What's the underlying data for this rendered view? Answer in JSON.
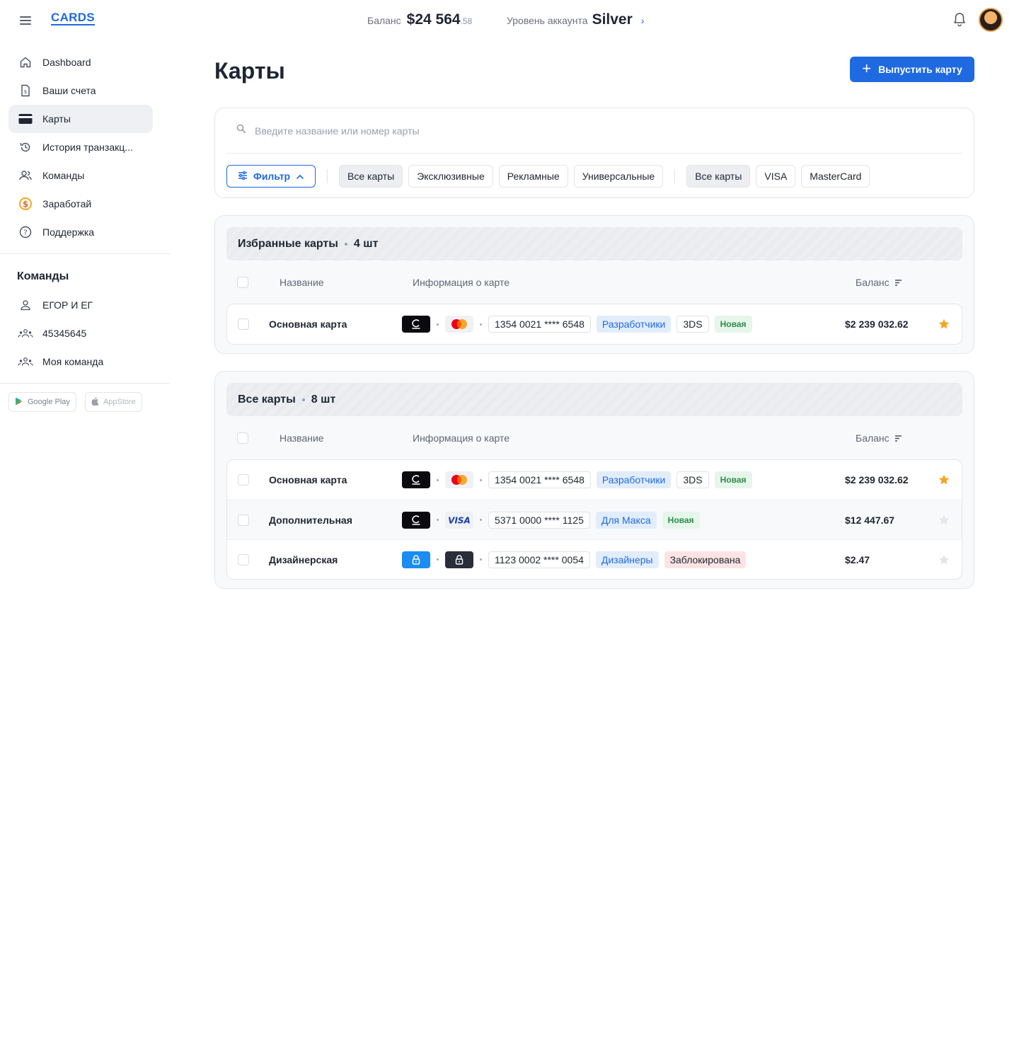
{
  "header": {
    "logo": "CARDS",
    "balance_label": "Баланс",
    "balance_main": "$24 564",
    "balance_cents": ".58",
    "level_label": "Уровень аккаунта",
    "level_value": "Silver"
  },
  "sidebar": {
    "items": [
      {
        "label": "Dashboard",
        "icon": "home-icon"
      },
      {
        "label": "Ваши счета",
        "icon": "document-dollar-icon"
      },
      {
        "label": "Карты",
        "icon": "card-icon",
        "active": true
      },
      {
        "label": "История транзакц...",
        "icon": "history-icon"
      },
      {
        "label": "Команды",
        "icon": "users-icon"
      },
      {
        "label": "Заработай",
        "icon": "dollar-coin-icon"
      },
      {
        "label": "Поддержка",
        "icon": "help-icon"
      }
    ],
    "teams_title": "Команды",
    "teams": [
      {
        "label": "ЕГОР И ЕГ",
        "icon": "user-icon"
      },
      {
        "label": "45345645",
        "icon": "team-icon"
      },
      {
        "label": "Моя команда",
        "icon": "team-icon"
      }
    ],
    "stores": {
      "google": "Google Play",
      "apple": "AppStore"
    }
  },
  "main": {
    "title": "Карты",
    "issue_button": "Выпустить карту",
    "search_placeholder": "Введите название или номер карты",
    "filter_button": "Фильтр",
    "type_chips": [
      "Все карты",
      "Эксклюзивные",
      "Рекламные",
      "Универсальные"
    ],
    "network_chips": [
      "Все карты",
      "VISA",
      "MasterCard"
    ],
    "columns": {
      "name": "Название",
      "info": "Информация о карте",
      "balance": "Баланс"
    },
    "favorites": {
      "title": "Избранные карты",
      "count": "4 шт",
      "rows": [
        {
          "name": "Основная карта",
          "brand": "c-logo",
          "network": "mastercard",
          "number": "1354 0021 **** 6548",
          "team": "Разработчики",
          "ds": "3DS",
          "status": "Новая",
          "status_type": "new",
          "balance": "$2 239 032.62",
          "starred": true
        }
      ]
    },
    "all": {
      "title": "Все карты",
      "count": "8 шт",
      "rows": [
        {
          "name": "Основная карта",
          "brand": "c-logo",
          "network": "mastercard",
          "number": "1354 0021 **** 6548",
          "team": "Разработчики",
          "ds": "3DS",
          "status": "Новая",
          "status_type": "new",
          "balance": "$2 239 032.62",
          "starred": true
        },
        {
          "name": "Дополнительная",
          "brand": "c-logo",
          "network": "visa",
          "number": "5371 0000 **** 1125",
          "team": "Для Макса",
          "ds": "",
          "status": "Новая",
          "status_type": "new",
          "balance": "$12 447.67",
          "starred": false
        },
        {
          "name": "Дизайнерская",
          "brand": "lock-blue",
          "network": "lock-dark",
          "number": "1123 0002 **** 0054",
          "team": "Дизайнеры",
          "ds": "",
          "status": "Заблокирована",
          "status_type": "blocked",
          "balance": "$2.47",
          "starred": false
        }
      ]
    },
    "colors": {
      "accent": "#1f6ae0",
      "star_on": "#f5a623",
      "star_off": "#e3e6ec",
      "new": "#2e8b4a",
      "blocked_bg": "#fde4e4"
    }
  }
}
